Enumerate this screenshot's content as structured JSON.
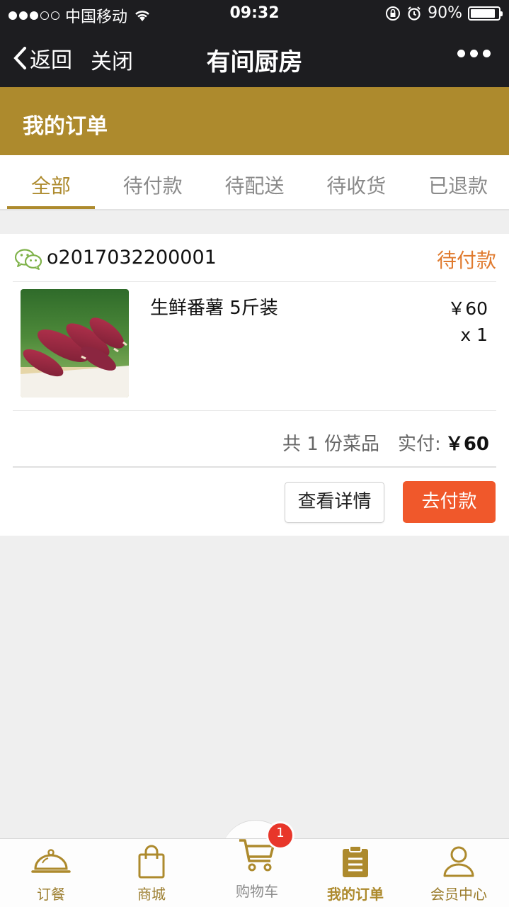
{
  "status_bar": {
    "carrier": "中国移动",
    "time": "09:32",
    "battery": "90%",
    "battery_level": 0.9,
    "signal_dots_filled": 3,
    "signal_dots_total": 5
  },
  "nav": {
    "back_label": "返回",
    "close_label": "关闭",
    "title": "有间厨房"
  },
  "header": {
    "title": "我的订单"
  },
  "tabs": [
    {
      "label": "全部",
      "active": true
    },
    {
      "label": "待付款",
      "active": false
    },
    {
      "label": "待配送",
      "active": false
    },
    {
      "label": "待收货",
      "active": false
    },
    {
      "label": "已退款",
      "active": false
    }
  ],
  "order": {
    "number": "o2017032200001",
    "status": "待付款",
    "item": {
      "name": "生鲜番薯 5斤装",
      "price": "￥60",
      "qty": "x 1"
    },
    "summary": {
      "count_text": "共 1 份菜品",
      "paid_label": "实付:",
      "paid_amount": "￥60"
    },
    "detail_button": "查看详情",
    "pay_button": "去付款"
  },
  "tabbar": {
    "items": [
      {
        "label": "订餐",
        "icon": "cloche-icon"
      },
      {
        "label": "商城",
        "icon": "shopping-bag-icon"
      },
      {
        "label": "购物车",
        "icon": "cart-icon"
      },
      {
        "label": "我的订单",
        "icon": "order-list-icon",
        "active": true
      },
      {
        "label": "会员中心",
        "icon": "user-icon"
      }
    ],
    "cart_badge": "1"
  },
  "colors": {
    "gold": "#ad8a2d",
    "dark": "#1d1d20",
    "pay_button": "#f0582b",
    "status_orange": "#e07a2e",
    "badge_red": "#e8362a"
  }
}
